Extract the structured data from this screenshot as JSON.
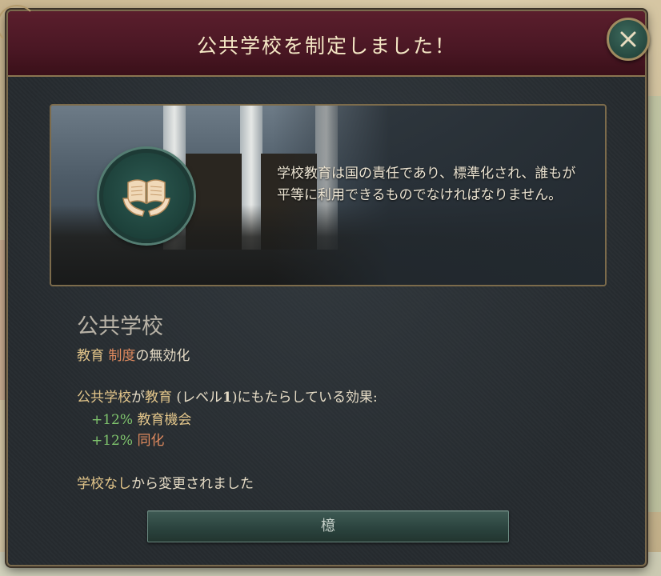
{
  "dialog": {
    "title": "公共学校を制定しました！",
    "close_icon": "close-icon",
    "quote": "学校教育は国の責任であり、標準化され、誰もが平等に利用できるものでなければなりません。",
    "emblem_icon": "book-in-hands-icon"
  },
  "law": {
    "name": "公共学校",
    "category": "教育",
    "institution_word": "制度",
    "deactivation_suffix": "の無効化",
    "effects_intro_law": "公共学校",
    "effects_intro_middle": "が",
    "effects_intro_institution": "教育",
    "effects_intro_level_open": " (レベル",
    "effects_intro_level_value": "1",
    "effects_intro_rest": ")にもたらしている効果:",
    "effects": [
      {
        "value": "+12%",
        "label": "教育機会"
      },
      {
        "value": "+12%",
        "label": "同化"
      }
    ],
    "changed_from_prefix": "学校なし",
    "changed_from_suffix": "から変更されました"
  },
  "buttons": {
    "ok_label": "檍"
  },
  "colors": {
    "header": "#4a1724",
    "panel": "#262b2f",
    "gold": "#e2c58a",
    "orange": "#e08a5e",
    "green": "#7fc46d",
    "button": "#2a423d"
  }
}
